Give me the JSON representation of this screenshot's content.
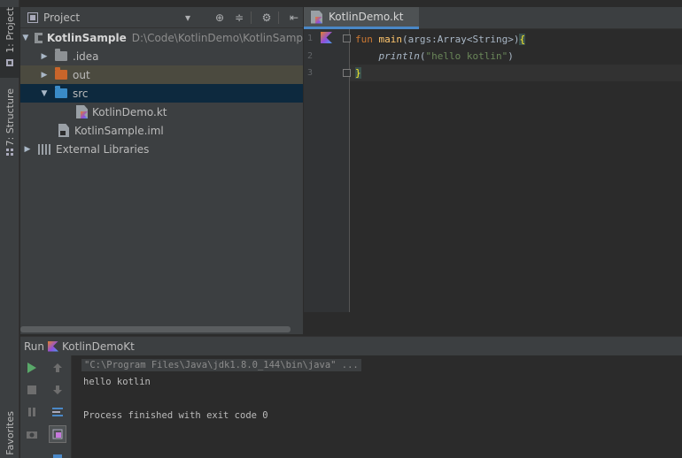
{
  "left_strip": {
    "project_tab": "1: Project",
    "structure_tab": "7: Structure",
    "favorites_tab": "Favorites"
  },
  "project_panel": {
    "title": "Project",
    "tree": [
      {
        "label": "KotlinSample",
        "path": "D:\\Code\\KotlinDemo\\KotlinSamp"
      },
      {
        "label": ".idea"
      },
      {
        "label": "out"
      },
      {
        "label": "src"
      },
      {
        "label": "KotlinDemo.kt"
      },
      {
        "label": "KotlinSample.iml"
      },
      {
        "label": "External Libraries"
      }
    ]
  },
  "editor": {
    "tab_label": "KotlinDemo.kt",
    "line_numbers": [
      "1",
      "2",
      "3"
    ],
    "code": {
      "l1_kw": "fun ",
      "l1_fn": "main",
      "l1_rest": "(args:Array<String>)",
      "l1_brace": "{",
      "l2_indent": "    ",
      "l2_call": "println",
      "l2_open": "(",
      "l2_str": "\"hello kotlin\"",
      "l2_close": ")",
      "l3_brace": "}"
    }
  },
  "run_panel": {
    "label": "Run",
    "config_name": "KotlinDemoKt",
    "console": {
      "command": "\"C:\\Program Files\\Java\\jdk1.8.0_144\\bin\\java\" ...",
      "output": "hello kotlin",
      "exit_message": "Process finished with exit code 0"
    }
  },
  "colors": {
    "keyword": "#cc7832",
    "function": "#ffc66d",
    "string": "#6a8759",
    "selection": "#0d293e",
    "run_green": "#59a869"
  }
}
